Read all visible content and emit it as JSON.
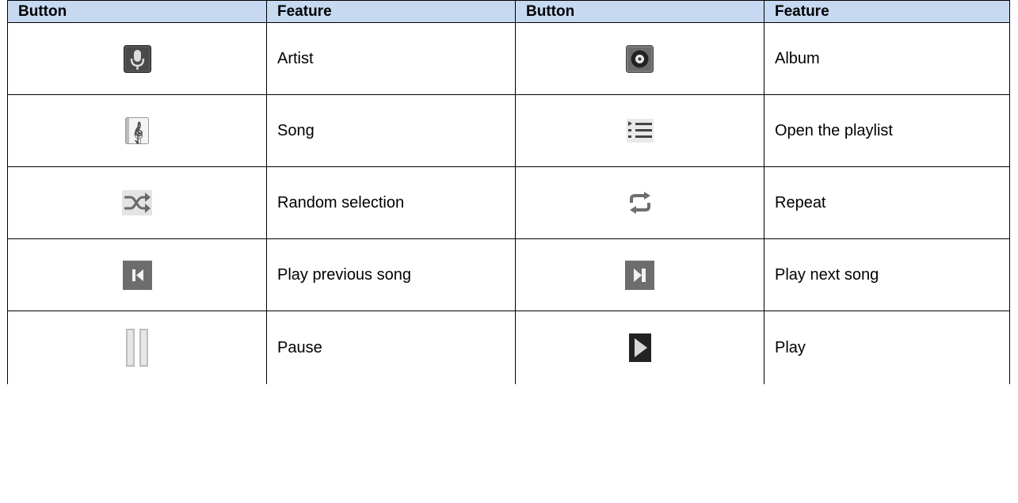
{
  "headers": [
    "Button",
    "Feature",
    "Button",
    "Feature"
  ],
  "rows": [
    [
      {
        "icon": "microphone-icon",
        "feature": "Artist"
      },
      {
        "icon": "album-disc-icon",
        "feature": "Album"
      }
    ],
    [
      {
        "icon": "treble-clef-icon",
        "feature": "Song"
      },
      {
        "icon": "playlist-icon",
        "feature": "Open the playlist"
      }
    ],
    [
      {
        "icon": "shuffle-icon",
        "feature": "Random selection"
      },
      {
        "icon": "repeat-icon",
        "feature": "Repeat"
      }
    ],
    [
      {
        "icon": "previous-track-icon",
        "feature": "Play previous song"
      },
      {
        "icon": "next-track-icon",
        "feature": "Play next song"
      }
    ],
    [
      {
        "icon": "pause-icon",
        "feature": "Pause"
      },
      {
        "icon": "play-icon",
        "feature": "Play"
      }
    ]
  ]
}
